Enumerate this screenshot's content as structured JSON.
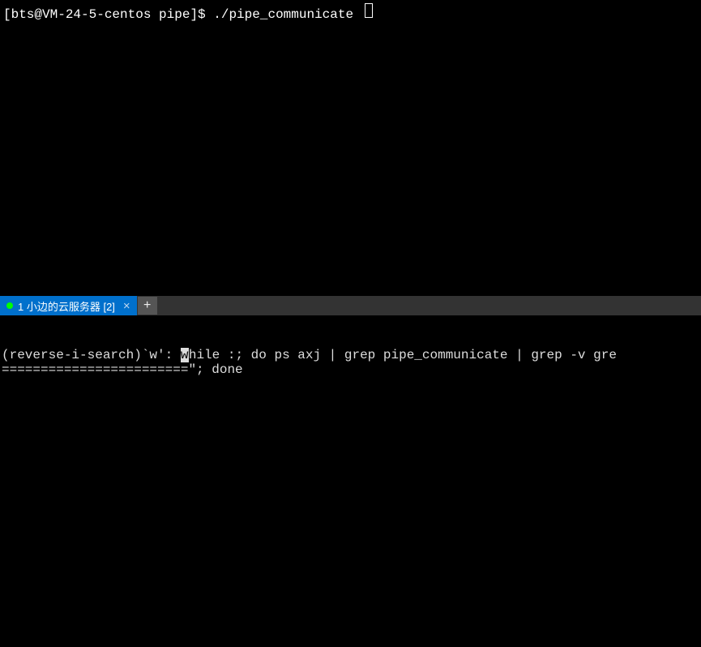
{
  "top_pane": {
    "prompt": "[bts@VM-24-5-centos pipe]$ ",
    "command": "./pipe_communicate "
  },
  "tab_bar": {
    "active_tab_label": "1 小边的云服务器 [2]",
    "close_glyph": "×",
    "new_tab_glyph": "+"
  },
  "bottom_pane": {
    "line1_prefix": "(reverse-i-search)`w': ",
    "line1_cursor_char": "w",
    "line1_rest": "hile :; do ps axj | grep pipe_communicate | grep -v gre",
    "line2": "========================\"; done"
  }
}
